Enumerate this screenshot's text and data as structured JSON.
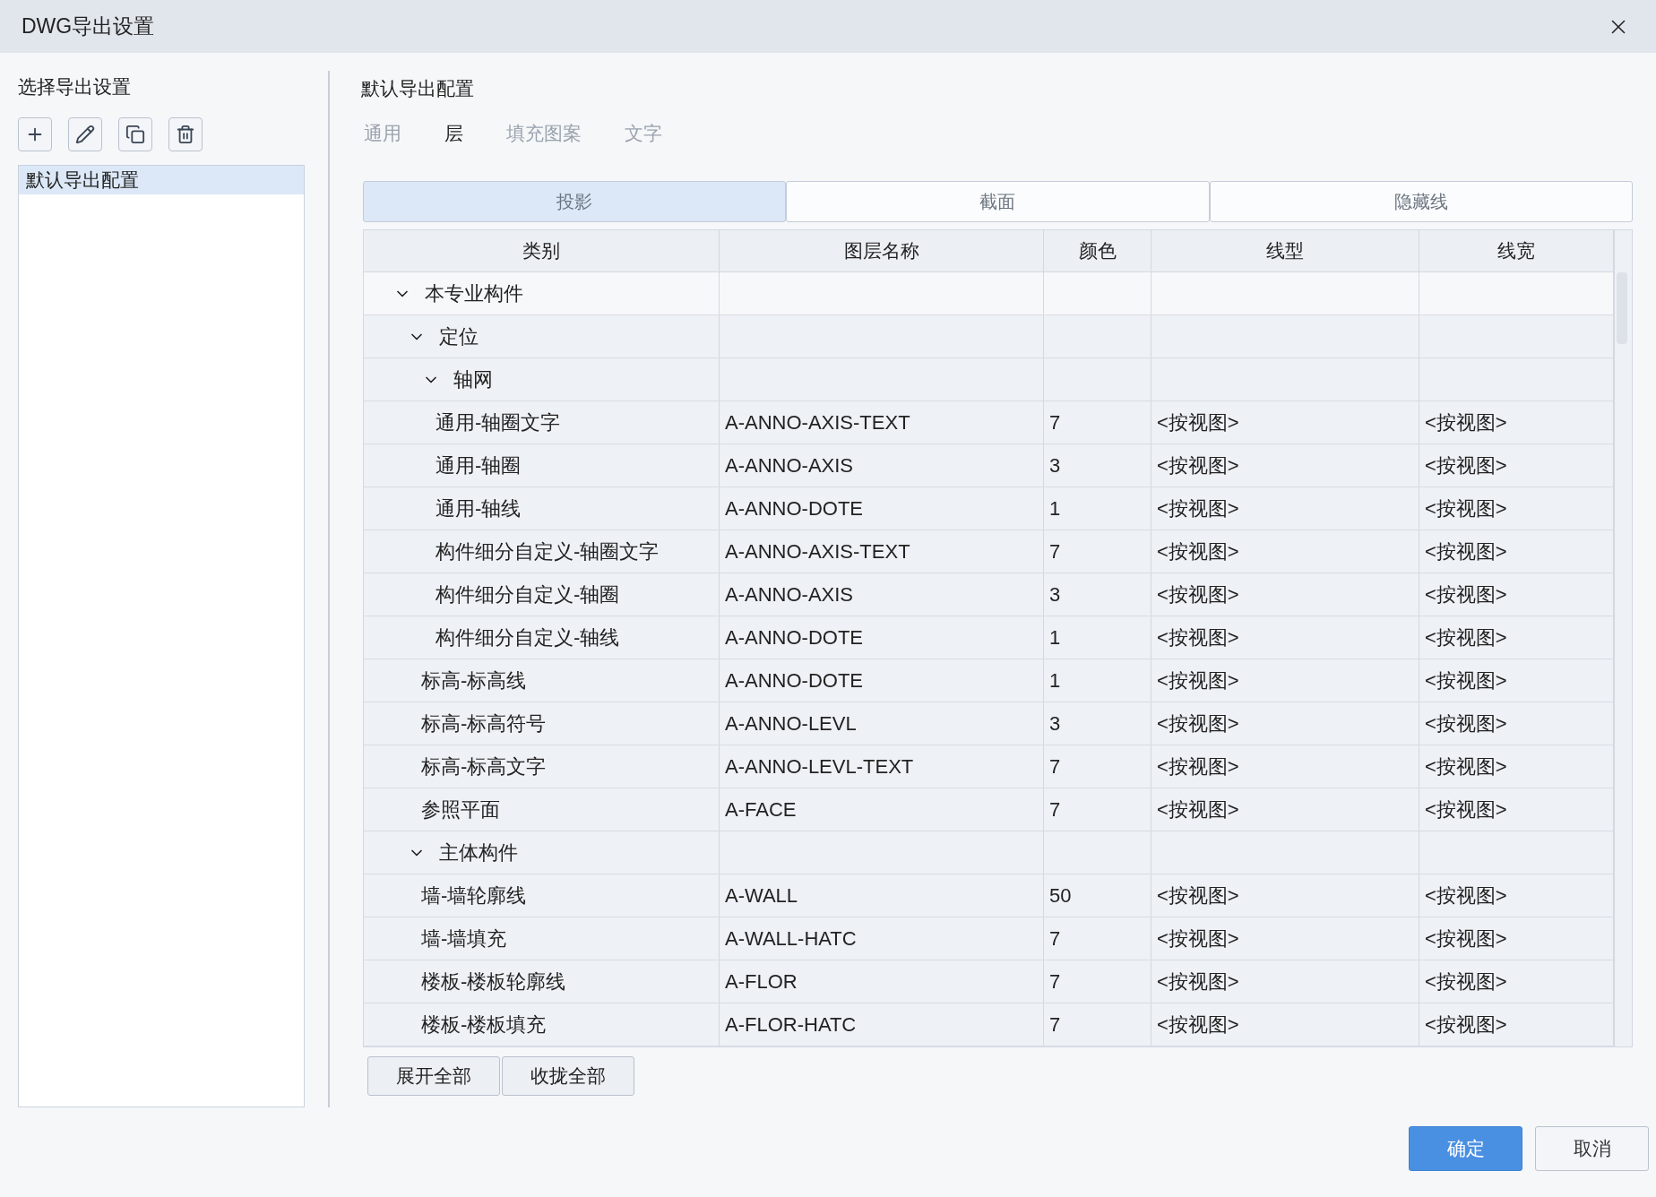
{
  "window": {
    "title": "DWG导出设置"
  },
  "sidebar": {
    "heading": "选择导出设置",
    "items": [
      {
        "label": "默认导出配置",
        "selected": true
      }
    ]
  },
  "config_title": "默认导出配置",
  "tabs": [
    {
      "label": "通用",
      "selected": false
    },
    {
      "label": "层",
      "selected": true
    },
    {
      "label": "填充图案",
      "selected": false
    },
    {
      "label": "文字",
      "selected": false
    }
  ],
  "view_tabs": [
    {
      "label": "投影",
      "selected": true
    },
    {
      "label": "截面",
      "selected": false
    },
    {
      "label": "隐藏线",
      "selected": false
    }
  ],
  "table": {
    "columns": [
      "类别",
      "图层名称",
      "颜色",
      "线型",
      "线宽"
    ],
    "rows": [
      {
        "label": "本专业构件",
        "expanded": true,
        "children": [
          {
            "label": "定位",
            "expanded": true,
            "children": [
              {
                "label": "轴网",
                "expanded": true,
                "children": [
                  {
                    "label": "通用-轴圈文字",
                    "cells": [
                      "A-ANNO-AXIS-TEXT",
                      "7",
                      "<按视图>",
                      "<按视图>"
                    ]
                  },
                  {
                    "label": "通用-轴圈",
                    "cells": [
                      "A-ANNO-AXIS",
                      "3",
                      "<按视图>",
                      "<按视图>"
                    ]
                  },
                  {
                    "label": "通用-轴线",
                    "cells": [
                      "A-ANNO-DOTE",
                      "1",
                      "<按视图>",
                      "<按视图>"
                    ]
                  },
                  {
                    "label": "构件细分自定义-轴圈文字",
                    "cells": [
                      "A-ANNO-AXIS-TEXT",
                      "7",
                      "<按视图>",
                      "<按视图>"
                    ]
                  },
                  {
                    "label": "构件细分自定义-轴圈",
                    "cells": [
                      "A-ANNO-AXIS",
                      "3",
                      "<按视图>",
                      "<按视图>"
                    ]
                  },
                  {
                    "label": "构件细分自定义-轴线",
                    "cells": [
                      "A-ANNO-DOTE",
                      "1",
                      "<按视图>",
                      "<按视图>"
                    ]
                  }
                ]
              },
              {
                "label": "标高-标高线",
                "cells": [
                  "A-ANNO-DOTE",
                  "1",
                  "<按视图>",
                  "<按视图>"
                ]
              },
              {
                "label": "标高-标高符号",
                "cells": [
                  "A-ANNO-LEVL",
                  "3",
                  "<按视图>",
                  "<按视图>"
                ]
              },
              {
                "label": "标高-标高文字",
                "cells": [
                  "A-ANNO-LEVL-TEXT",
                  "7",
                  "<按视图>",
                  "<按视图>"
                ]
              },
              {
                "label": "参照平面",
                "cells": [
                  "A-FACE",
                  "7",
                  "<按视图>",
                  "<按视图>"
                ]
              }
            ]
          },
          {
            "label": "主体构件",
            "expanded": true,
            "children": [
              {
                "label": "墙-墙轮廓线",
                "cells": [
                  "A-WALL",
                  "50",
                  "<按视图>",
                  "<按视图>"
                ]
              },
              {
                "label": "墙-墙填充",
                "cells": [
                  "A-WALL-HATC",
                  "7",
                  "<按视图>",
                  "<按视图>"
                ]
              },
              {
                "label": "楼板-楼板轮廓线",
                "cells": [
                  "A-FLOR",
                  "7",
                  "<按视图>",
                  "<按视图>"
                ]
              },
              {
                "label": "楼板-楼板填充",
                "cells": [
                  "A-FLOR-HATC",
                  "7",
                  "<按视图>",
                  "<按视图>"
                ]
              }
            ]
          }
        ]
      }
    ]
  },
  "table_buttons": [
    "展开全部",
    "收拢全部"
  ],
  "buttons": [
    {
      "label": "确定",
      "kind": "primary"
    },
    {
      "label": "取消",
      "kind": "secondary"
    }
  ]
}
